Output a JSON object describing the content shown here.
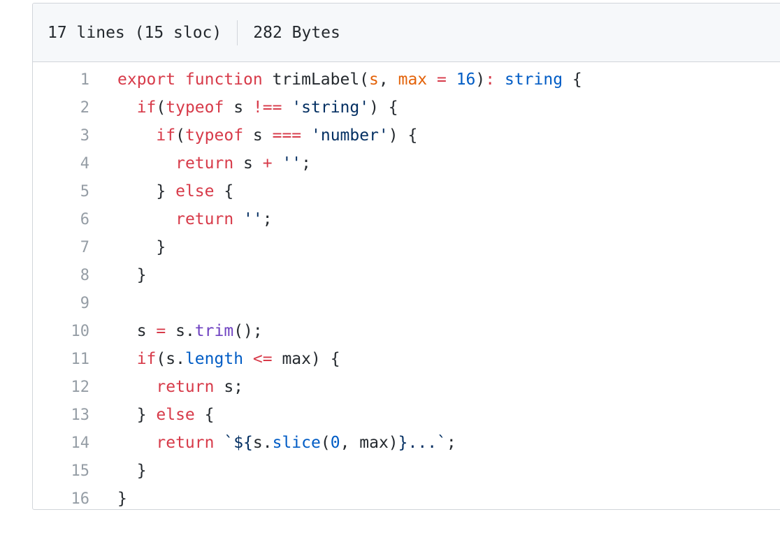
{
  "file_info": {
    "lines": "17 lines (15 sloc)",
    "size": "282 Bytes"
  },
  "colors": {
    "keyword": "#d73a49",
    "param": "#e36209",
    "constant": "#005cc5",
    "string": "#032f62",
    "method": "#6f42c1",
    "plain": "#24292e",
    "line_number": "#959da5"
  },
  "code_lines": [
    {
      "num": "1",
      "tokens": [
        {
          "t": "export function ",
          "c": "keyword"
        },
        {
          "t": "trimLabel(",
          "c": "plain"
        },
        {
          "t": "s",
          "c": "param"
        },
        {
          "t": ", ",
          "c": "plain"
        },
        {
          "t": "max",
          "c": "param"
        },
        {
          "t": " = ",
          "c": "keyword"
        },
        {
          "t": "16",
          "c": "const"
        },
        {
          "t": ")",
          "c": "plain"
        },
        {
          "t": ": ",
          "c": "keyword"
        },
        {
          "t": "string",
          "c": "const"
        },
        {
          "t": " {",
          "c": "plain"
        }
      ]
    },
    {
      "num": "2",
      "tokens": [
        {
          "t": "  ",
          "c": "plain"
        },
        {
          "t": "if",
          "c": "keyword"
        },
        {
          "t": "(",
          "c": "plain"
        },
        {
          "t": "typeof",
          "c": "keyword"
        },
        {
          "t": " s ",
          "c": "plain"
        },
        {
          "t": "!==",
          "c": "keyword"
        },
        {
          "t": " ",
          "c": "plain"
        },
        {
          "t": "'string'",
          "c": "string"
        },
        {
          "t": ") {",
          "c": "plain"
        }
      ]
    },
    {
      "num": "3",
      "tokens": [
        {
          "t": "    ",
          "c": "plain"
        },
        {
          "t": "if",
          "c": "keyword"
        },
        {
          "t": "(",
          "c": "plain"
        },
        {
          "t": "typeof",
          "c": "keyword"
        },
        {
          "t": " s ",
          "c": "plain"
        },
        {
          "t": "===",
          "c": "keyword"
        },
        {
          "t": " ",
          "c": "plain"
        },
        {
          "t": "'number'",
          "c": "string"
        },
        {
          "t": ") {",
          "c": "plain"
        }
      ]
    },
    {
      "num": "4",
      "tokens": [
        {
          "t": "      ",
          "c": "plain"
        },
        {
          "t": "return",
          "c": "keyword"
        },
        {
          "t": " s ",
          "c": "plain"
        },
        {
          "t": "+",
          "c": "keyword"
        },
        {
          "t": " ",
          "c": "plain"
        },
        {
          "t": "''",
          "c": "string"
        },
        {
          "t": ";",
          "c": "plain"
        }
      ]
    },
    {
      "num": "5",
      "tokens": [
        {
          "t": "    } ",
          "c": "plain"
        },
        {
          "t": "else",
          "c": "keyword"
        },
        {
          "t": " {",
          "c": "plain"
        }
      ]
    },
    {
      "num": "6",
      "tokens": [
        {
          "t": "      ",
          "c": "plain"
        },
        {
          "t": "return",
          "c": "keyword"
        },
        {
          "t": " ",
          "c": "plain"
        },
        {
          "t": "''",
          "c": "string"
        },
        {
          "t": ";",
          "c": "plain"
        }
      ]
    },
    {
      "num": "7",
      "tokens": [
        {
          "t": "    }",
          "c": "plain"
        }
      ]
    },
    {
      "num": "8",
      "tokens": [
        {
          "t": "  }",
          "c": "plain"
        }
      ]
    },
    {
      "num": "9",
      "tokens": [
        {
          "t": "",
          "c": "plain"
        }
      ]
    },
    {
      "num": "10",
      "tokens": [
        {
          "t": "  s ",
          "c": "plain"
        },
        {
          "t": "=",
          "c": "keyword"
        },
        {
          "t": " s.",
          "c": "plain"
        },
        {
          "t": "trim",
          "c": "method"
        },
        {
          "t": "();",
          "c": "plain"
        }
      ]
    },
    {
      "num": "11",
      "tokens": [
        {
          "t": "  ",
          "c": "plain"
        },
        {
          "t": "if",
          "c": "keyword"
        },
        {
          "t": "(s.",
          "c": "plain"
        },
        {
          "t": "length",
          "c": "const"
        },
        {
          "t": " ",
          "c": "plain"
        },
        {
          "t": "<=",
          "c": "keyword"
        },
        {
          "t": " max) {",
          "c": "plain"
        }
      ]
    },
    {
      "num": "12",
      "tokens": [
        {
          "t": "    ",
          "c": "plain"
        },
        {
          "t": "return",
          "c": "keyword"
        },
        {
          "t": " s;",
          "c": "plain"
        }
      ]
    },
    {
      "num": "13",
      "tokens": [
        {
          "t": "  } ",
          "c": "plain"
        },
        {
          "t": "else",
          "c": "keyword"
        },
        {
          "t": " {",
          "c": "plain"
        }
      ]
    },
    {
      "num": "14",
      "tokens": [
        {
          "t": "    ",
          "c": "plain"
        },
        {
          "t": "return",
          "c": "keyword"
        },
        {
          "t": " ",
          "c": "plain"
        },
        {
          "t": "`${",
          "c": "string"
        },
        {
          "t": "s.",
          "c": "plain"
        },
        {
          "t": "slice",
          "c": "const"
        },
        {
          "t": "(",
          "c": "plain"
        },
        {
          "t": "0",
          "c": "const"
        },
        {
          "t": ", max)",
          "c": "plain"
        },
        {
          "t": "}...`",
          "c": "string"
        },
        {
          "t": ";",
          "c": "plain"
        }
      ]
    },
    {
      "num": "15",
      "tokens": [
        {
          "t": "  }",
          "c": "plain"
        }
      ]
    },
    {
      "num": "16",
      "tokens": [
        {
          "t": "}",
          "c": "plain"
        }
      ]
    }
  ]
}
